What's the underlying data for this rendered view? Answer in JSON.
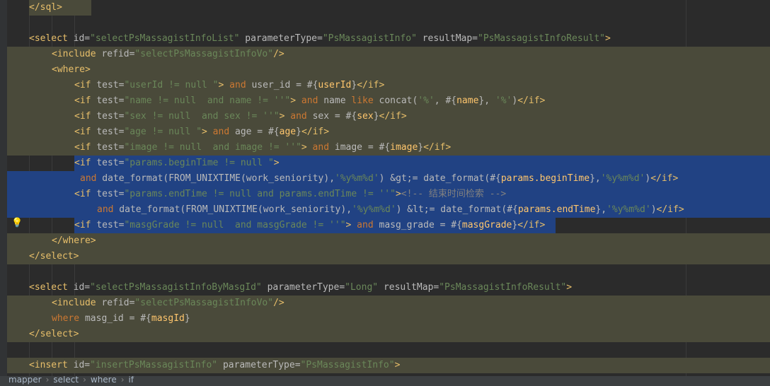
{
  "editor": {
    "lines": [
      {
        "tokens": [
          {
            "c": "t",
            "s": "</sql>"
          }
        ]
      },
      {
        "tokens": []
      },
      {
        "tokens": [
          {
            "c": "t",
            "s": "<select "
          },
          {
            "c": "a",
            "s": "id="
          },
          {
            "c": "v",
            "s": "\"selectPsMassagistInfoList\""
          },
          {
            "c": "a",
            "s": " parameterType="
          },
          {
            "c": "v",
            "s": "\"PsMassagistInfo\""
          },
          {
            "c": "a",
            "s": " resultMap="
          },
          {
            "c": "v",
            "s": "\"PsMassagistInfoResult\""
          },
          {
            "c": "t",
            "s": ">"
          }
        ]
      },
      {
        "tokens": [
          {
            "c": "t",
            "s": "<include "
          },
          {
            "c": "a",
            "s": "refid="
          },
          {
            "c": "v",
            "s": "\"selectPsMassagistInfoVo\""
          },
          {
            "c": "t",
            "s": "/>"
          }
        ]
      },
      {
        "tokens": [
          {
            "c": "t",
            "s": "<where>"
          }
        ]
      },
      {
        "tokens": [
          {
            "c": "t",
            "s": "<if "
          },
          {
            "c": "a",
            "s": "test="
          },
          {
            "c": "v",
            "s": "\"userId != null \""
          },
          {
            "c": "t",
            "s": ">"
          },
          {
            "c": "k",
            "s": " and"
          },
          {
            "c": "a",
            "s": " user_id = #{"
          },
          {
            "c": "f",
            "s": "userId"
          },
          {
            "c": "a",
            "s": "}"
          },
          {
            "c": "t",
            "s": "</if>"
          }
        ]
      },
      {
        "tokens": [
          {
            "c": "t",
            "s": "<if "
          },
          {
            "c": "a",
            "s": "test="
          },
          {
            "c": "v",
            "s": "\"name != null  and name != ''\""
          },
          {
            "c": "t",
            "s": ">"
          },
          {
            "c": "k",
            "s": " and"
          },
          {
            "c": "a",
            "s": " name "
          },
          {
            "c": "k",
            "s": "like"
          },
          {
            "c": "a",
            "s": " concat("
          },
          {
            "c": "v",
            "s": "'%'"
          },
          {
            "c": "a",
            "s": ", #{"
          },
          {
            "c": "f",
            "s": "name"
          },
          {
            "c": "a",
            "s": "}, "
          },
          {
            "c": "v",
            "s": "'%'"
          },
          {
            "c": "a",
            "s": ")"
          },
          {
            "c": "t",
            "s": "</if>"
          }
        ]
      },
      {
        "tokens": [
          {
            "c": "t",
            "s": "<if "
          },
          {
            "c": "a",
            "s": "test="
          },
          {
            "c": "v",
            "s": "\"sex != null  and sex != ''\""
          },
          {
            "c": "t",
            "s": ">"
          },
          {
            "c": "k",
            "s": " and"
          },
          {
            "c": "a",
            "s": " sex = #{"
          },
          {
            "c": "f",
            "s": "sex"
          },
          {
            "c": "a",
            "s": "}"
          },
          {
            "c": "t",
            "s": "</if>"
          }
        ]
      },
      {
        "tokens": [
          {
            "c": "t",
            "s": "<if "
          },
          {
            "c": "a",
            "s": "test="
          },
          {
            "c": "v",
            "s": "\"age != null \""
          },
          {
            "c": "t",
            "s": ">"
          },
          {
            "c": "k",
            "s": " and"
          },
          {
            "c": "a",
            "s": " age = #{"
          },
          {
            "c": "f",
            "s": "age"
          },
          {
            "c": "a",
            "s": "}"
          },
          {
            "c": "t",
            "s": "</if>"
          }
        ]
      },
      {
        "tokens": [
          {
            "c": "t",
            "s": "<if "
          },
          {
            "c": "a",
            "s": "test="
          },
          {
            "c": "v",
            "s": "\"image != null  and image != ''\""
          },
          {
            "c": "t",
            "s": ">"
          },
          {
            "c": "k",
            "s": " and"
          },
          {
            "c": "a",
            "s": " image = #{"
          },
          {
            "c": "f",
            "s": "image"
          },
          {
            "c": "a",
            "s": "}"
          },
          {
            "c": "t",
            "s": "</if>"
          }
        ]
      },
      {
        "tokens": [
          {
            "c": "t",
            "s": "<if "
          },
          {
            "c": "a",
            "s": "test="
          },
          {
            "c": "v",
            "s": "\"params.beginTime != null \""
          },
          {
            "c": "t",
            "s": ">"
          }
        ]
      },
      {
        "tokens": [
          {
            "c": "k",
            "s": "and"
          },
          {
            "c": "a",
            "s": " date_format(FROM_UNIXTIME(work_seniority),"
          },
          {
            "c": "v",
            "s": "'%y%m%d'"
          },
          {
            "c": "a",
            "s": ") &gt;= date_format(#{"
          },
          {
            "c": "f",
            "s": "params.beginTime"
          },
          {
            "c": "a",
            "s": "},"
          },
          {
            "c": "v",
            "s": "'%y%m%d'"
          },
          {
            "c": "a",
            "s": ")"
          },
          {
            "c": "t",
            "s": "</if>"
          }
        ]
      },
      {
        "tokens": [
          {
            "c": "t",
            "s": "<if "
          },
          {
            "c": "a",
            "s": "test="
          },
          {
            "c": "v",
            "s": "\"params.endTime != null and params.endTime != ''\""
          },
          {
            "c": "t",
            "s": ">"
          },
          {
            "c": "cm",
            "s": "<!-- 结束时间检索 -->"
          }
        ]
      },
      {
        "tokens": [
          {
            "c": "k",
            "s": "and"
          },
          {
            "c": "a",
            "s": " date_format(FROM_UNIXTIME(work_seniority),"
          },
          {
            "c": "v",
            "s": "'%y%m%d'"
          },
          {
            "c": "a",
            "s": ") &lt;= date_format(#{"
          },
          {
            "c": "f",
            "s": "params.endTime"
          },
          {
            "c": "a",
            "s": "},"
          },
          {
            "c": "v",
            "s": "'%y%m%d'"
          },
          {
            "c": "a",
            "s": ")"
          },
          {
            "c": "t",
            "s": "</if>"
          }
        ]
      },
      {
        "tokens": [
          {
            "c": "t",
            "s": "<if "
          },
          {
            "c": "a",
            "s": "test="
          },
          {
            "c": "v",
            "s": "\"masgGrade != null  and masgGrade != ''\""
          },
          {
            "c": "t",
            "s": ">"
          },
          {
            "c": "k",
            "s": " and"
          },
          {
            "c": "a",
            "s": " masg_grade = #{"
          },
          {
            "c": "f",
            "s": "masgGrade"
          },
          {
            "c": "a",
            "s": "}"
          },
          {
            "c": "t",
            "s": "</if>"
          }
        ]
      },
      {
        "tokens": [
          {
            "c": "t",
            "s": "</where>"
          }
        ]
      },
      {
        "tokens": [
          {
            "c": "t",
            "s": "</select>"
          }
        ]
      },
      {
        "tokens": []
      },
      {
        "tokens": [
          {
            "c": "t",
            "s": "<select "
          },
          {
            "c": "a",
            "s": "id="
          },
          {
            "c": "v",
            "s": "\"selectPsMassagistInfoByMasgId\""
          },
          {
            "c": "a",
            "s": " parameterType="
          },
          {
            "c": "v",
            "s": "\"Long\""
          },
          {
            "c": "a",
            "s": " resultMap="
          },
          {
            "c": "v",
            "s": "\"PsMassagistInfoResult\""
          },
          {
            "c": "t",
            "s": ">"
          }
        ]
      },
      {
        "tokens": [
          {
            "c": "t",
            "s": "<include "
          },
          {
            "c": "a",
            "s": "refid="
          },
          {
            "c": "v",
            "s": "\"selectPsMassagistInfoVo\""
          },
          {
            "c": "t",
            "s": "/>"
          }
        ]
      },
      {
        "tokens": [
          {
            "c": "k",
            "s": "where"
          },
          {
            "c": "a",
            "s": " masg_id = #{"
          },
          {
            "c": "f",
            "s": "masgId"
          },
          {
            "c": "a",
            "s": "}"
          }
        ]
      },
      {
        "tokens": [
          {
            "c": "t",
            "s": "</select>"
          }
        ]
      },
      {
        "tokens": []
      },
      {
        "tokens": [
          {
            "c": "t",
            "s": "<insert "
          },
          {
            "c": "a",
            "s": "id="
          },
          {
            "c": "v",
            "s": "\"insertPsMassagistInfo\""
          },
          {
            "c": "a",
            "s": " parameterType="
          },
          {
            "c": "v",
            "s": "\"PsMassagistInfo\""
          },
          {
            "c": "t",
            "s": ">"
          }
        ]
      }
    ]
  },
  "breadcrumb": [
    "mapper",
    "select",
    "where",
    "if"
  ],
  "colors": {
    "background": "#2b2b2b",
    "scope_highlight": "#4a4a3a",
    "selection": "#214283",
    "intention_bulb": "#f2c94c"
  },
  "icons": {
    "gutter_action": "lightbulb-icon"
  }
}
